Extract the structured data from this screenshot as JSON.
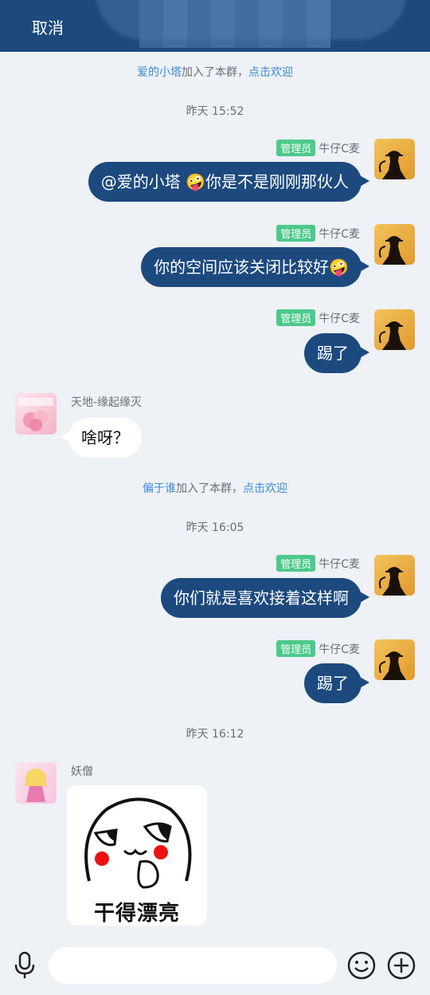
{
  "header": {
    "cancel_label": "取消"
  },
  "events": {
    "join1": {
      "user": "爱的小塔",
      "text": "加入了本群，",
      "action": "点击欢迎"
    },
    "time1": "昨天 15:52",
    "join2": {
      "user": "偏于谁",
      "text": "加入了本群，",
      "action": "点击欢迎"
    },
    "time2": "昨天 16:05",
    "time3": "昨天 16:12"
  },
  "messages": [
    {
      "role": "管理员",
      "sender": "牛仔C麦",
      "text": "@爱的小塔 🤪你是不是刚刚那伙人"
    },
    {
      "role": "管理员",
      "sender": "牛仔C麦",
      "text": "你的空间应该关闭比较好🤪"
    },
    {
      "role": "管理员",
      "sender": "牛仔C麦",
      "text": "踢了"
    },
    {
      "sender": "天地-缘起缘灭",
      "text": "啥呀？"
    },
    {
      "role": "管理员",
      "sender": "牛仔C麦",
      "text": "你们就是喜欢接着这样啊"
    },
    {
      "role": "管理员",
      "sender": "牛仔C麦",
      "text": "踢了"
    },
    {
      "sender": "妖僧",
      "sticker_caption": "干得漂亮"
    }
  ],
  "colors": {
    "header": "#1c4a7e",
    "bubble_out": "#1c4a7e",
    "badge": "#4cc98a",
    "link": "#3a8ad8"
  },
  "icons": {
    "voice": "microphone-icon",
    "emoji": "smile-icon",
    "more": "plus-icon"
  }
}
